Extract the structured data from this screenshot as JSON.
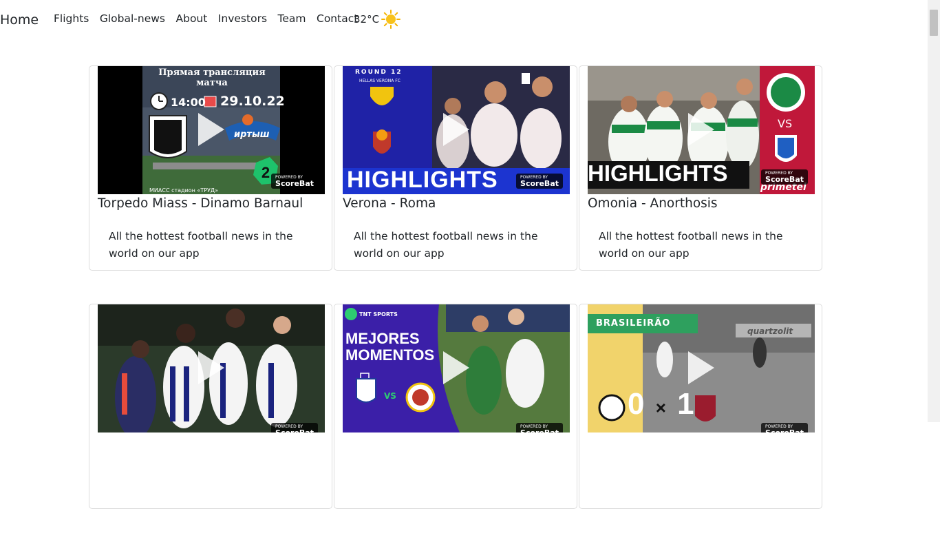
{
  "nav": {
    "brand": "Home",
    "links": [
      "Flights",
      "Global-news",
      "About",
      "Investors",
      "Team",
      "Contact"
    ]
  },
  "weather": {
    "temperature": "32°C",
    "icon": "sun-icon"
  },
  "badge": {
    "powered": "POWERED BY",
    "brand": "ScoreBat"
  },
  "cards": [
    {
      "title": "Torpedo Miass - Dinamo Barnaul",
      "text": "All the hottest football news in the world on our app",
      "thumb": {
        "header": "Прямая трансляция матча",
        "time": "14:00",
        "date": "29.10.22",
        "away_name": "иртыш",
        "footer": "МИАСС стадион «ТРУД»"
      }
    },
    {
      "title": "Verona - Roma",
      "text": "All the hottest football news in the world on our app",
      "thumb": {
        "round": "ROUND 12",
        "club": "HELLAS VERONA FC",
        "banner": "HIGHLIGHTS"
      }
    },
    {
      "title": "Omonia - Anorthosis",
      "text": "All the hottest football news in the world on our app",
      "thumb": {
        "banner": "HIGHLIGHTS",
        "vs": "VS",
        "sponsor": "primetel"
      }
    },
    {
      "title": "",
      "text": "",
      "thumb": {}
    },
    {
      "title": "",
      "text": "",
      "thumb": {
        "brand": "TNT SPORTS",
        "heading": "MEJORES MOMENTOS",
        "vs": "VS"
      }
    },
    {
      "title": "",
      "text": "",
      "thumb": {
        "league": "BRASILEIRÃO",
        "score_home": "0",
        "score_sep": "×",
        "score_away": "1",
        "board": "quartzolit"
      }
    }
  ]
}
